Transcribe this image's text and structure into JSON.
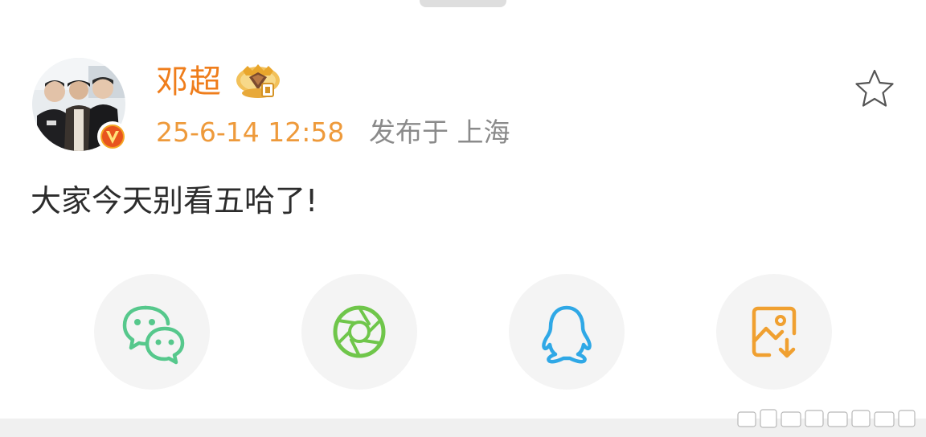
{
  "post": {
    "author": "邓超",
    "time": "25-6-14 12:58",
    "location": "发布于 上海",
    "text": "大家今天别看五哈了!"
  },
  "icons": {
    "verified": "verified-v-badge",
    "crown": "crown-member-badge",
    "star": "star-outline-icon",
    "wechat": "wechat-icon",
    "moments": "moments-aperture-icon",
    "qq": "qq-penguin-icon",
    "save": "save-image-icon"
  },
  "colors": {
    "username": "#ef7d1b",
    "time": "#ee9a3b",
    "wechat": "#56c88c",
    "moments": "#6fc64a",
    "qq": "#2fa8e6",
    "save": "#f0a030"
  }
}
